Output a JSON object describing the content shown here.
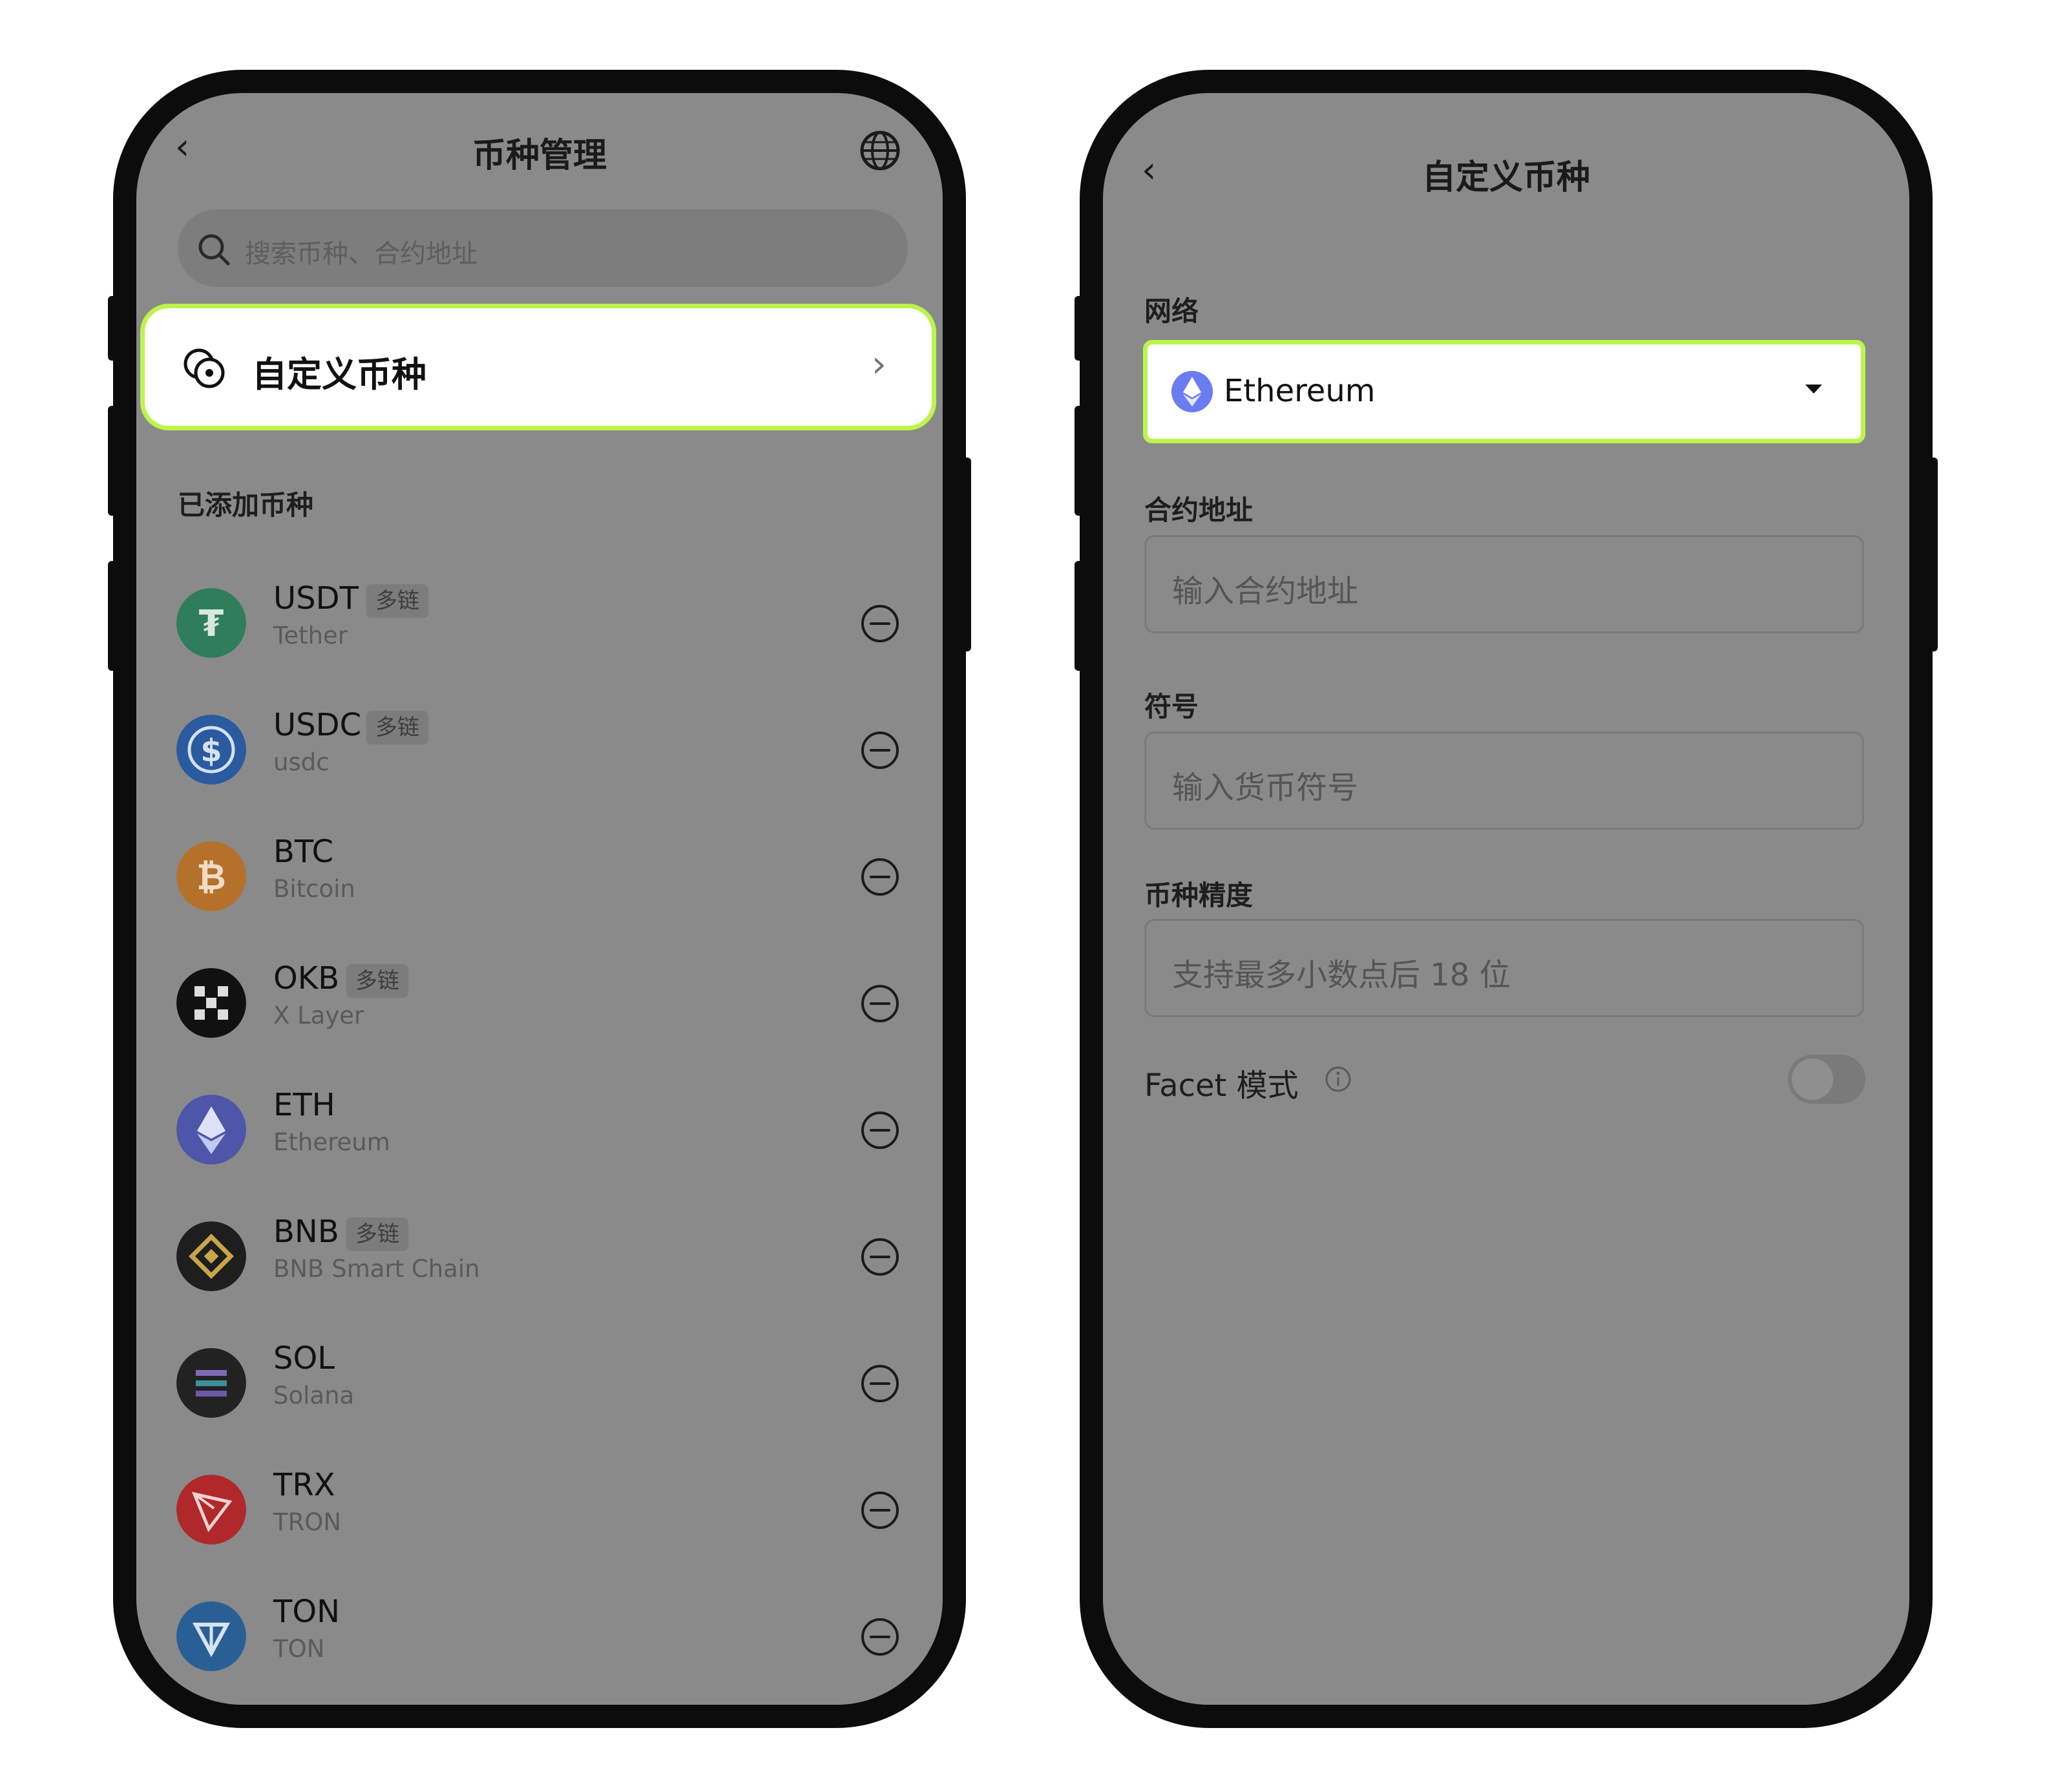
{
  "left_screen": {
    "header": {
      "back": "‹",
      "title": "币种管理",
      "globe_icon": "globe-icon"
    },
    "search": {
      "placeholder": "搜索币种、合约地址"
    },
    "custom_entry": {
      "label": "自定义币种",
      "chevron": "›"
    },
    "section_label": "已添加币种",
    "coins": [
      {
        "symbol": "USDT",
        "name": "Tether",
        "tag": "多链",
        "logo": "usdt-logo",
        "color": "#2f7d5b"
      },
      {
        "symbol": "USDC",
        "name": "usdc",
        "tag": "多链",
        "logo": "usdc-logo",
        "color": "#2a5aa0"
      },
      {
        "symbol": "BTC",
        "name": "Bitcoin",
        "tag": "",
        "logo": "btc-logo",
        "color": "#b5702a"
      },
      {
        "symbol": "OKB",
        "name": "X Layer",
        "tag": "多链",
        "logo": "okb-logo",
        "color": "#111111"
      },
      {
        "symbol": "ETH",
        "name": "Ethereum",
        "tag": "",
        "logo": "eth-logo",
        "color": "#4d56a8"
      },
      {
        "symbol": "BNB",
        "name": "BNB Smart Chain",
        "tag": "多链",
        "logo": "bnb-logo",
        "color": "#1e1e1e"
      },
      {
        "symbol": "SOL",
        "name": "Solana",
        "tag": "",
        "logo": "sol-logo",
        "color": "#222222"
      },
      {
        "symbol": "TRX",
        "name": "TRON",
        "tag": "",
        "logo": "trx-logo",
        "color": "#b0282a"
      },
      {
        "symbol": "TON",
        "name": "TON",
        "tag": "",
        "logo": "ton-logo",
        "color": "#2a5f96"
      }
    ]
  },
  "right_screen": {
    "header": {
      "back": "‹",
      "title": "自定义币种"
    },
    "network": {
      "label": "网络",
      "value": "Ethereum",
      "icon": "ethereum-icon"
    },
    "contract": {
      "label": "合约地址",
      "placeholder": "输入合约地址"
    },
    "symbol": {
      "label": "符号",
      "placeholder": "输入货币符号"
    },
    "precision": {
      "label": "币种精度",
      "placeholder": "支持最多小数点后 18 位"
    },
    "facet": {
      "label": "Facet 模式",
      "enabled": false
    }
  },
  "colors": {
    "highlight": "#bdf44a",
    "overlay": "#8a8a8a"
  }
}
